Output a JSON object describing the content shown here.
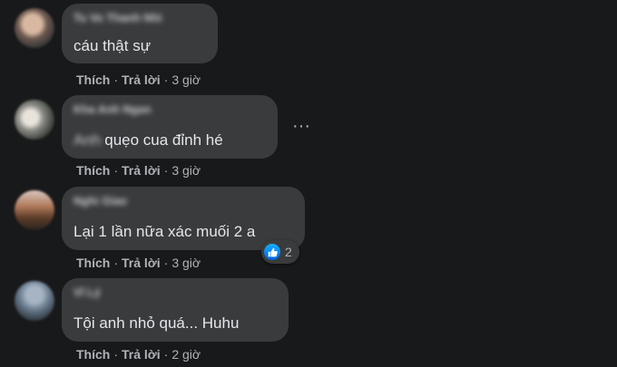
{
  "comments": [
    {
      "author": "Tu Vo Thanh Nhi",
      "prefix": "",
      "text": "cáu thật sự",
      "like_label": "Thích",
      "reply_label": "Trả lời",
      "time": "3 giờ"
    },
    {
      "author": "Kha Anh Ngan",
      "prefix": "Anh",
      "text": "quẹo cua đỉnh hé",
      "like_label": "Thích",
      "reply_label": "Trả lời",
      "time": "3 giờ",
      "more_icon": "more-horizontal-icon"
    },
    {
      "author": "Nghi Giao",
      "prefix": "",
      "text": "Lại 1 lần nữa xác muối 2 a",
      "like_label": "Thích",
      "reply_label": "Trả lời",
      "time": "3 giờ",
      "reaction": {
        "icon": "like-icon",
        "count": "2",
        "color": "#1877f2"
      }
    },
    {
      "author": "Vĩ Lý",
      "prefix": "",
      "text": "Tội anh nhỏ quá... Huhu",
      "like_label": "Thích",
      "reply_label": "Trả lời",
      "time": "2 giờ"
    }
  ],
  "separator": "·"
}
